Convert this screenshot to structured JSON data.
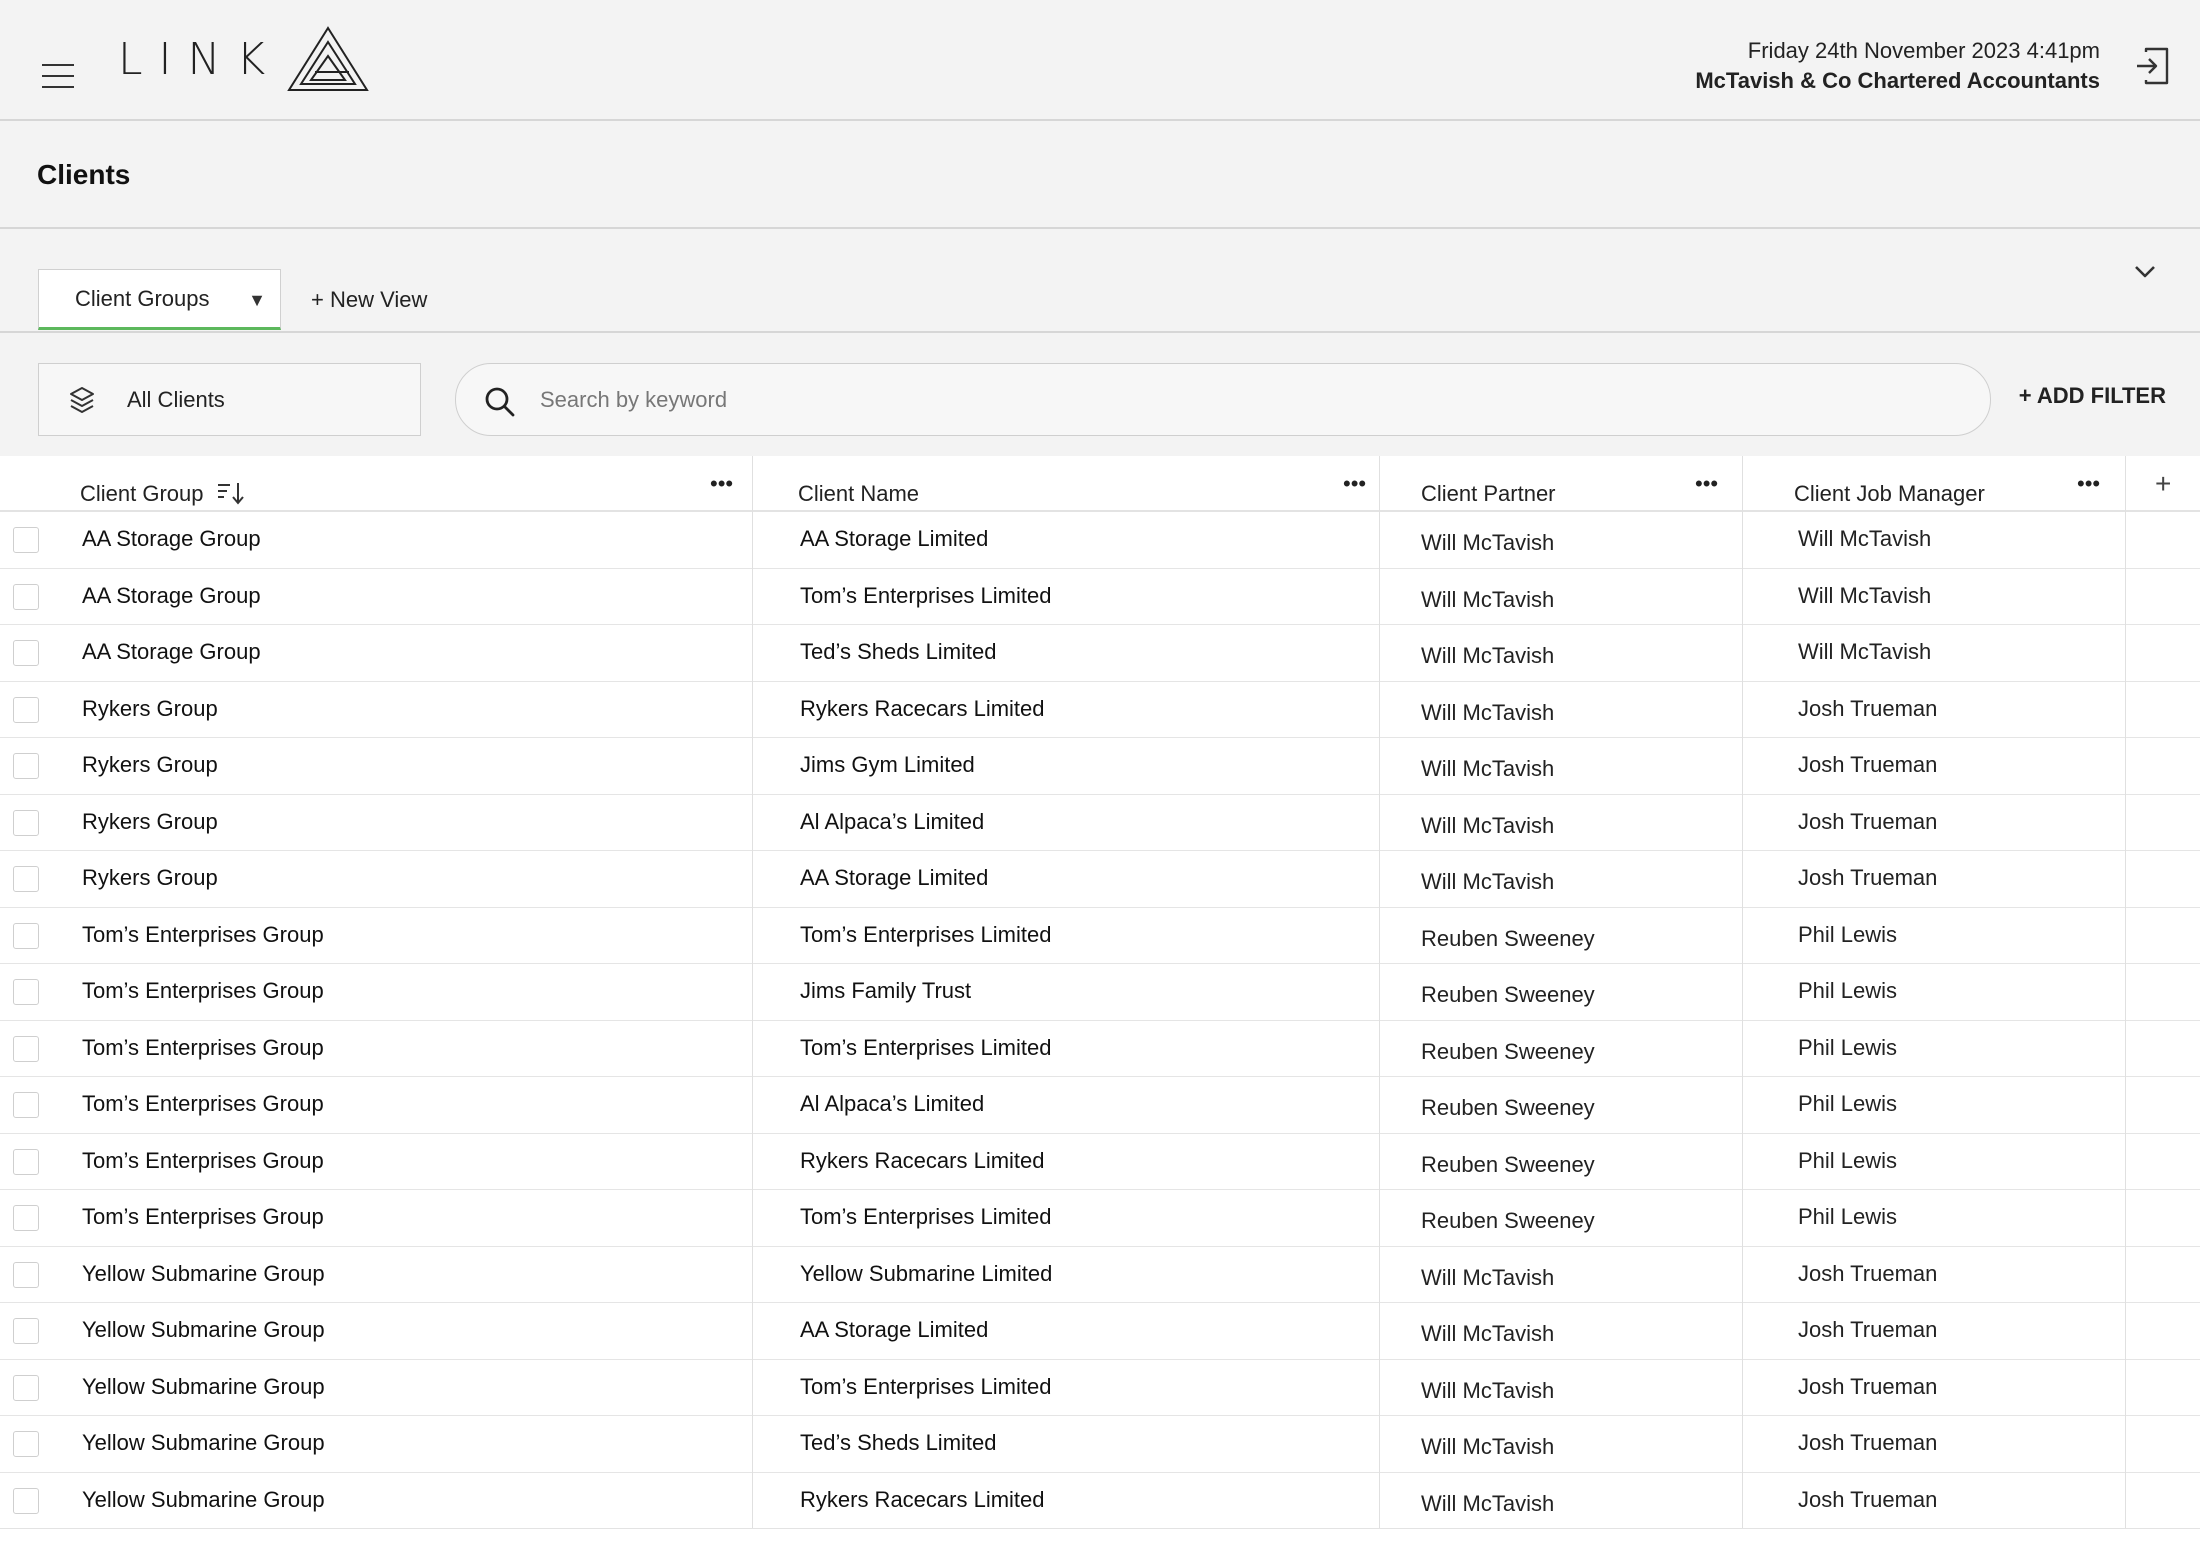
{
  "header": {
    "logo_text": "LINK",
    "date_time": "Friday 24th November 2023  4:41pm",
    "firm_name": "McTavish & Co Chartered Accountants"
  },
  "page": {
    "title": "Clients"
  },
  "tabs": {
    "active_tab": "Client Groups",
    "new_view_label": "+ New View"
  },
  "filters": {
    "view_label": "All Clients",
    "search_placeholder": "Search by keyword",
    "add_filter_label": "+ ADD FILTER"
  },
  "table": {
    "columns": [
      "Client Group",
      "Client Name",
      "Client Partner",
      "Client Job Manager"
    ],
    "rows": [
      [
        "AA Storage Group",
        "AA Storage Limited",
        "Will McTavish",
        "Will McTavish"
      ],
      [
        "AA Storage Group",
        "Tom’s Enterprises Limited",
        "Will McTavish",
        "Will McTavish"
      ],
      [
        "AA Storage Group",
        "Ted’s Sheds Limited",
        "Will McTavish",
        "Will McTavish"
      ],
      [
        "Rykers Group",
        "Rykers Racecars Limited",
        "Will McTavish",
        "Josh Trueman"
      ],
      [
        "Rykers Group",
        "Jims Gym Limited",
        "Will McTavish",
        "Josh Trueman"
      ],
      [
        "Rykers Group",
        "Al Alpaca’s Limited",
        "Will McTavish",
        "Josh Trueman"
      ],
      [
        "Rykers Group",
        "AA Storage Limited",
        "Will McTavish",
        "Josh Trueman"
      ],
      [
        "Tom’s Enterprises Group",
        "Tom’s Enterprises Limited",
        "Reuben Sweeney",
        "Phil Lewis"
      ],
      [
        "Tom’s Enterprises Group",
        "Jims Family Trust",
        "Reuben Sweeney",
        "Phil Lewis"
      ],
      [
        "Tom’s Enterprises Group",
        "Tom’s Enterprises Limited",
        "Reuben Sweeney",
        "Phil Lewis"
      ],
      [
        "Tom’s Enterprises Group",
        "Al Alpaca’s Limited",
        "Reuben Sweeney",
        "Phil Lewis"
      ],
      [
        "Tom’s Enterprises Group",
        "Rykers Racecars Limited",
        "Reuben Sweeney",
        "Phil Lewis"
      ],
      [
        "Tom’s Enterprises Group",
        "Tom’s Enterprises Limited",
        "Reuben Sweeney",
        "Phil Lewis"
      ],
      [
        "Yellow Submarine Group",
        "Yellow Submarine Limited",
        "Will McTavish",
        "Josh Trueman"
      ],
      [
        "Yellow Submarine Group",
        "AA Storage Limited",
        "Will McTavish",
        "Josh Trueman"
      ],
      [
        "Yellow Submarine Group",
        "Tom’s Enterprises Limited",
        "Will McTavish",
        "Josh Trueman"
      ],
      [
        "Yellow Submarine Group",
        "Ted’s Sheds Limited",
        "Will McTavish",
        "Josh Trueman"
      ],
      [
        "Yellow Submarine Group",
        "Rykers Racecars Limited",
        "Will McTavish",
        "Josh Trueman"
      ]
    ]
  },
  "colors": {
    "tab_accent": "#5cb85c",
    "background": "#f3f3f3",
    "table_background": "#ffffff",
    "border": "#d6d6d6"
  },
  "icons": [
    "hamburger-icon",
    "logo-mark-icon",
    "logout-icon",
    "dropdown-caret-icon",
    "chevron-down-icon",
    "layers-icon",
    "search-icon",
    "sort-icon",
    "more-icon",
    "plus-icon",
    "checkbox-icon"
  ]
}
